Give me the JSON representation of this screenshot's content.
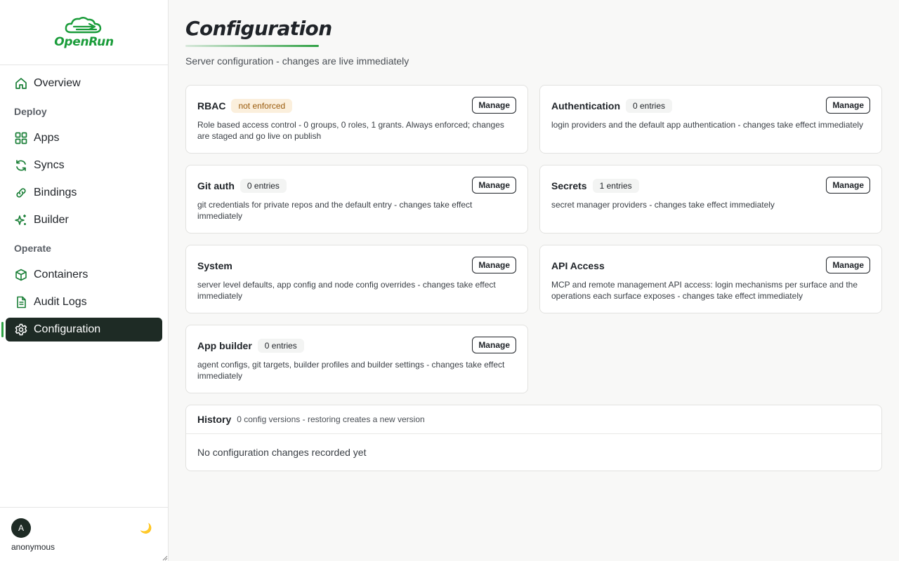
{
  "app": {
    "name": "OpenRun"
  },
  "sidebar": {
    "items": [
      {
        "label": "Overview"
      },
      {
        "section": "Deploy"
      },
      {
        "label": "Apps"
      },
      {
        "label": "Syncs"
      },
      {
        "label": "Bindings"
      },
      {
        "label": "Builder"
      },
      {
        "section": "Operate"
      },
      {
        "label": "Containers"
      },
      {
        "label": "Audit Logs"
      },
      {
        "label": "Configuration",
        "active": true
      }
    ]
  },
  "user": {
    "initial": "A",
    "name": "anonymous",
    "theme_icon": "🌙"
  },
  "page": {
    "title": "Configuration",
    "subtitle": "Server configuration - changes are live immediately"
  },
  "cards": [
    {
      "title": "RBAC",
      "badge": "not enforced",
      "manage": "Manage",
      "description": "Role based access control - 0 groups, 0 roles, 1 grants. Always enforced; changes are staged and go live on publish"
    },
    {
      "title": "Authentication",
      "badge": "0 entries",
      "manage": "Manage",
      "description": "login providers and the default app authentication - changes take effect immediately"
    },
    {
      "title": "Git auth",
      "badge": "0 entries",
      "manage": "Manage",
      "description": "git credentials for private repos and the default entry - changes take effect immediately"
    },
    {
      "title": "Secrets",
      "badge": "1 entries",
      "manage": "Manage",
      "description": "secret manager providers - changes take effect immediately"
    },
    {
      "title": "System",
      "manage": "Manage",
      "description": "server level defaults, app config and node config overrides - changes take effect immediately"
    },
    {
      "title": "API Access",
      "manage": "Manage",
      "description": "MCP and remote management API access: login mechanisms per surface and the operations each surface exposes - changes take effect immediately"
    },
    {
      "title": "App builder",
      "badge": "0 entries",
      "manage": "Manage",
      "description": "agent configs, git targets, builder profiles and builder settings - changes take effect immediately"
    }
  ],
  "history": {
    "title": "History",
    "meta": "0 config versions - restoring creates a new version",
    "empty": "No configuration changes recorded yet"
  },
  "colors": {
    "brand": "#1a9c3a",
    "active_bg": "#1e2b25",
    "warn_bg": "#fbefdc",
    "warn_text": "#9a5b0d"
  }
}
